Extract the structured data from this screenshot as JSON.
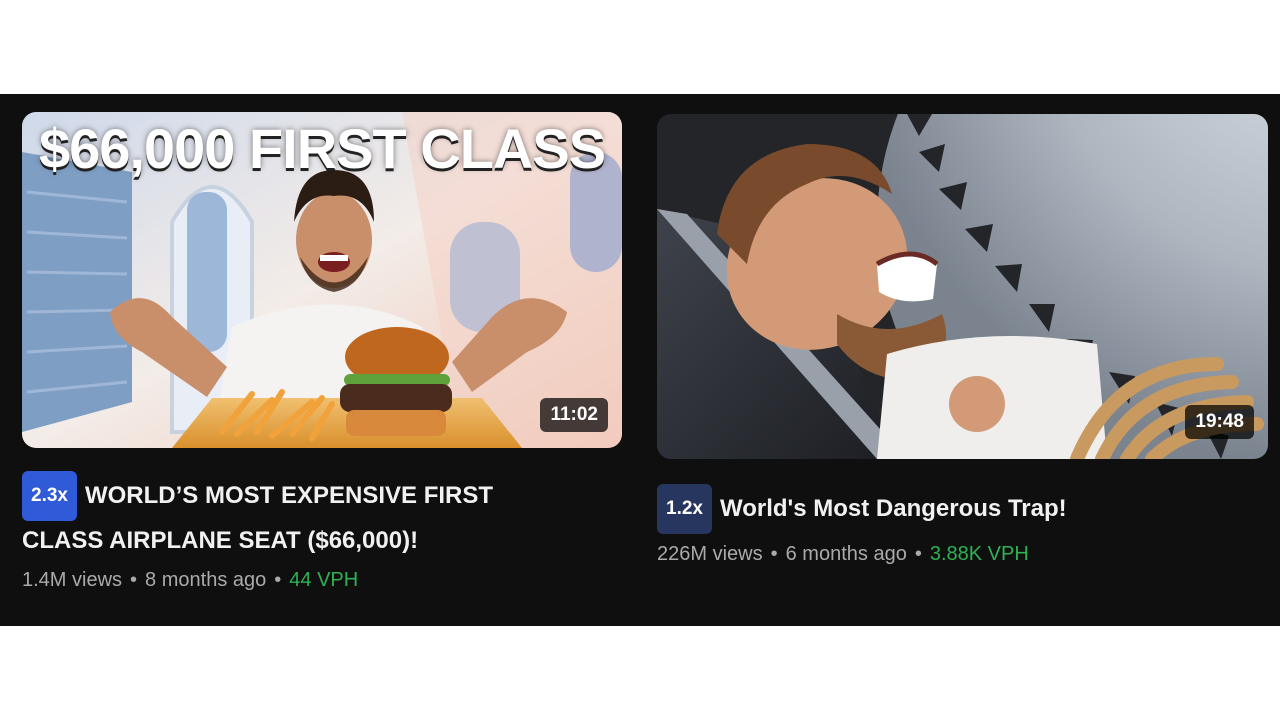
{
  "colors": {
    "background": "#0f0f0f",
    "title_text": "#f1f1f1",
    "meta_text": "#aaaaaa",
    "vph_green": "#2fb154",
    "badge_blue": "#2f5ad8",
    "badge_navy": "#27365e"
  },
  "videos": [
    {
      "thumbnail_text": "$66,000 FIRST CLASS",
      "duration": "11:02",
      "badge": "2.3x",
      "title_line1": "WORLD’S MOST EXPENSIVE FIRST",
      "title_line2": "CLASS AIRPLANE SEAT ($66,000)!",
      "views": "1.4M views",
      "age": "8 months ago",
      "vph": "44 VPH",
      "separator": "•"
    },
    {
      "duration": "19:48",
      "badge": "1.2x",
      "title": "World's Most Dangerous Trap!",
      "views": "226M views",
      "age": "6 months ago",
      "vph": "3.88K VPH",
      "separator": "•"
    }
  ]
}
